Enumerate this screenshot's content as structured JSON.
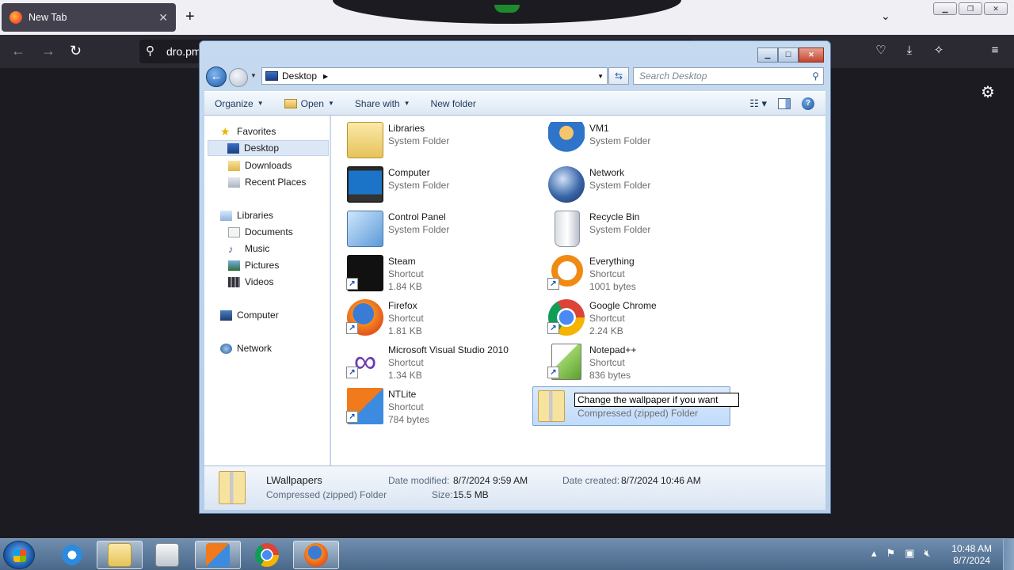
{
  "browser": {
    "tab_title": "New Tab",
    "url_text": "dro.pm",
    "new_tab_symbol": "+"
  },
  "explorer": {
    "address": "Desktop",
    "search_placeholder": "Search Desktop",
    "toolbar": {
      "organize": "Organize",
      "open": "Open",
      "share_with": "Share with",
      "new_folder": "New folder"
    },
    "nav": {
      "favorites": "Favorites",
      "desktop": "Desktop",
      "downloads": "Downloads",
      "recent_places": "Recent Places",
      "libraries": "Libraries",
      "documents": "Documents",
      "music": "Music",
      "pictures": "Pictures",
      "videos": "Videos",
      "computer": "Computer",
      "network": "Network"
    },
    "items": [
      {
        "name": "Libraries",
        "type": "System Folder",
        "size": "",
        "icon": "libraries-icon"
      },
      {
        "name": "VM1",
        "type": "System Folder",
        "size": "",
        "icon": "user-icon"
      },
      {
        "name": "Computer",
        "type": "System Folder",
        "size": "",
        "icon": "computer-icon"
      },
      {
        "name": "Network",
        "type": "System Folder",
        "size": "",
        "icon": "network-icon"
      },
      {
        "name": "Control Panel",
        "type": "System Folder",
        "size": "",
        "icon": "control-panel-icon"
      },
      {
        "name": "Recycle Bin",
        "type": "System Folder",
        "size": "",
        "icon": "recycle-bin-icon"
      },
      {
        "name": "Steam",
        "type": "Shortcut",
        "size": "1.84 KB",
        "icon": "steam-icon"
      },
      {
        "name": "Everything",
        "type": "Shortcut",
        "size": "1001 bytes",
        "icon": "everything-icon"
      },
      {
        "name": "Firefox",
        "type": "Shortcut",
        "size": "1.81 KB",
        "icon": "firefox-icon"
      },
      {
        "name": "Google Chrome",
        "type": "Shortcut",
        "size": "2.24 KB",
        "icon": "chrome-icon"
      },
      {
        "name": "Microsoft Visual Studio 2010",
        "type": "Shortcut",
        "size": "1.34 KB",
        "icon": "visual-studio-icon"
      },
      {
        "name": "Notepad++",
        "type": "Shortcut",
        "size": "836 bytes",
        "icon": "notepadpp-icon"
      },
      {
        "name": "NTLite",
        "type": "Shortcut",
        "size": "784 bytes",
        "icon": "ntlite-icon"
      },
      {
        "name": "Change the wallpaper if you want",
        "type": "Compressed (zipped) Folder",
        "size": "",
        "icon": "zip-folder-icon"
      }
    ],
    "details": {
      "name": "LWallpapers",
      "type": "Compressed (zipped) Folder",
      "date_modified_label": "Date modified:",
      "date_modified": "8/7/2024 9:59 AM",
      "date_created_label": "Date created:",
      "date_created": "8/7/2024 10:46 AM",
      "size_label": "Size:",
      "size": "15.5 MB"
    }
  },
  "taskbar": {
    "time": "10:48 AM",
    "date": "8/7/2024"
  }
}
